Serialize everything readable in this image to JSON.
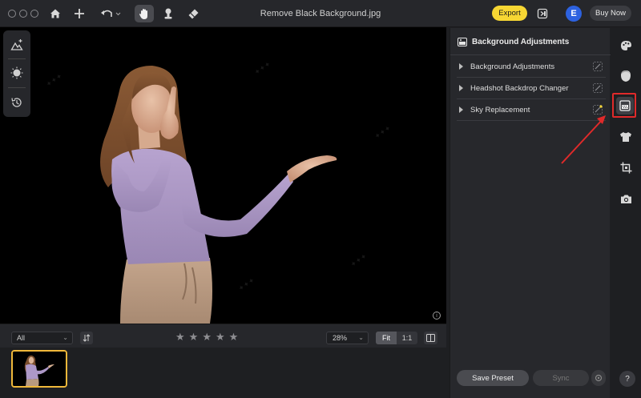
{
  "window": {
    "title": "Remove Black Background.jpg"
  },
  "toolbar": {
    "home_icon": "home-icon",
    "add_icon": "plus-icon",
    "undo_icon": "undo-icon",
    "hand_icon": "hand-icon",
    "stamp_icon": "stamp-icon",
    "eraser_icon": "eraser-icon",
    "export_label": "Export",
    "share_icon": "share-icon",
    "avatar_letter": "E",
    "buy_now_label": "Buy Now",
    "accent_color": "#f6d633"
  },
  "left_tools": {
    "items": [
      "mountain-sparkle-icon",
      "sun-icon",
      "history-icon"
    ]
  },
  "bottom_bar": {
    "filter_value": "All",
    "sort_icon": "sort-icon",
    "rating_max": 5,
    "rating_value": 0,
    "zoom_value": "28%",
    "fit_label": "Fit",
    "one_to_one_label": "1:1",
    "compare_icon": "compare-icon"
  },
  "filmstrip": {
    "selected_index": 0,
    "thumb_border_color": "#f0b83a"
  },
  "panel": {
    "title": "Background Adjustments",
    "rows": [
      {
        "label": "Background Adjustments"
      },
      {
        "label": "Headshot Backdrop Changer"
      },
      {
        "label": "Sky Replacement"
      }
    ],
    "save_preset_label": "Save Preset",
    "sync_label": "Sync"
  },
  "rail": {
    "items": [
      "palette-icon",
      "face-icon",
      "background-icon",
      "shirt-icon",
      "crop-icon",
      "camera-icon"
    ],
    "active_index": 2,
    "highlight_color": "#e02a2a",
    "help_label": "?"
  }
}
